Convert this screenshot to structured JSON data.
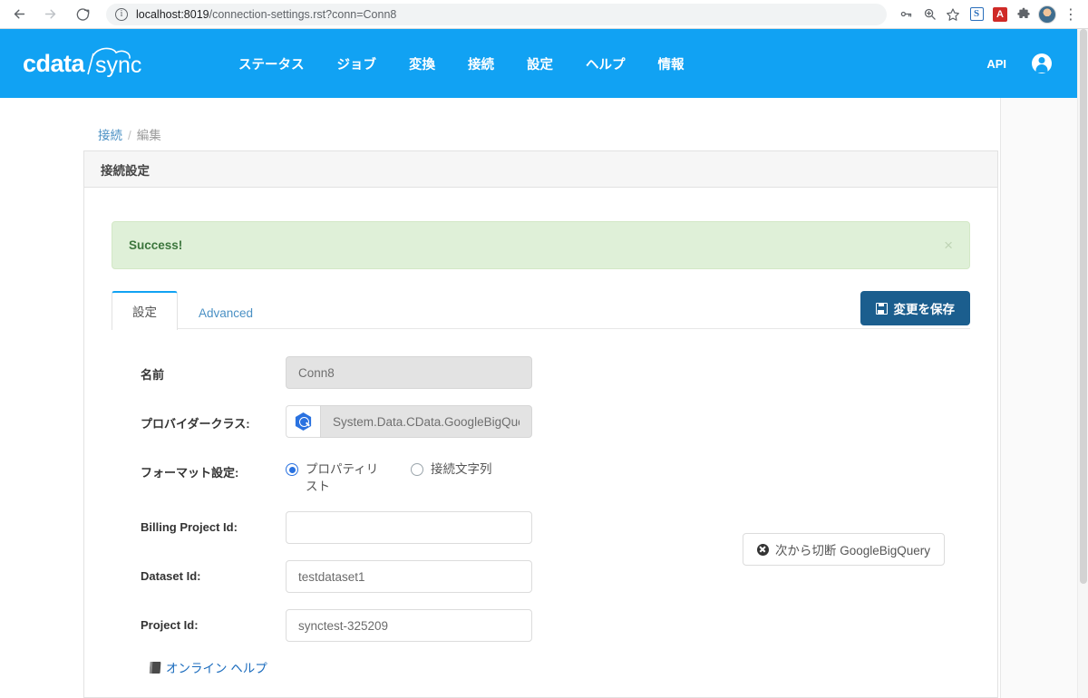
{
  "browser": {
    "back_icon": "back-arrow-icon",
    "forward_icon": "forward-arrow-icon",
    "reload_icon": "reload-icon",
    "site_info_icon": "info-icon",
    "url_host": "localhost:8019",
    "url_path": "/connection-settings.rst?conn=Conn8",
    "url_full": "localhost:8019/connection-settings.rst?conn=Conn8",
    "toolbar_icons": [
      {
        "name": "password-key-icon",
        "glyph": "⚷"
      },
      {
        "name": "zoom-icon",
        "glyph": "⊕"
      },
      {
        "name": "bookmark-star-icon",
        "glyph": "☆"
      },
      {
        "name": "extension-s-icon",
        "glyph": "S"
      },
      {
        "name": "adobe-pdf-icon",
        "glyph": "A"
      },
      {
        "name": "extensions-puzzle-icon",
        "glyph": "❖"
      },
      {
        "name": "profile-avatar",
        "glyph": ""
      },
      {
        "name": "chrome-menu-icon",
        "glyph": "⋮"
      }
    ]
  },
  "header": {
    "brand": "cdata sync",
    "brand_primary": "cdata",
    "brand_secondary": "sync",
    "nav": [
      {
        "label": "ステータス",
        "name": "nav-status"
      },
      {
        "label": "ジョブ",
        "name": "nav-jobs"
      },
      {
        "label": "変換",
        "name": "nav-transform"
      },
      {
        "label": "接続",
        "name": "nav-connections"
      },
      {
        "label": "設定",
        "name": "nav-settings"
      },
      {
        "label": "ヘルプ",
        "name": "nav-help"
      },
      {
        "label": "情報",
        "name": "nav-info"
      }
    ],
    "api_label": "API",
    "user_icon": "user-account-icon",
    "background_color": "#11a2f3"
  },
  "breadcrumb": {
    "parent": "接続",
    "separator": "/",
    "current": "編集"
  },
  "panel": {
    "title": "接続設定"
  },
  "alert": {
    "message": "Success!",
    "close_label": "×",
    "background_color": "#dff0d8",
    "text_color": "#3c763d"
  },
  "tabs": [
    {
      "label": "設定",
      "name": "tab-settings",
      "active": true
    },
    {
      "label": "Advanced",
      "name": "tab-advanced",
      "active": false
    }
  ],
  "toolbar": {
    "save_label": "変更を保存",
    "save_icon": "save-floppy-icon",
    "save_color": "#1b5e8e"
  },
  "form": {
    "fields": [
      {
        "name": "connection-name",
        "label": "名前",
        "value": "Conn8",
        "placeholder": "",
        "disabled": true,
        "type": "text"
      },
      {
        "name": "provider-class",
        "label": "プロバイダークラス:",
        "value": "System.Data.CData.GoogleBigQue",
        "placeholder": "",
        "disabled": true,
        "type": "text-with-icon",
        "icon": "google-bigquery-icon"
      },
      {
        "name": "billing-project-id",
        "label": "Billing Project Id:",
        "value": "",
        "placeholder": "",
        "disabled": false,
        "type": "text"
      },
      {
        "name": "dataset-id",
        "label": "Dataset Id:",
        "value": "testdataset1",
        "placeholder": "",
        "disabled": false,
        "type": "text"
      },
      {
        "name": "project-id",
        "label": "Project Id:",
        "value": "synctest-325209",
        "placeholder": "",
        "disabled": false,
        "type": "text"
      }
    ],
    "format_setting": {
      "label": "フォーマット設定:",
      "options": [
        {
          "label": "プロパティリスト",
          "name": "radio-property-list",
          "selected": true
        },
        {
          "label": "接続文字列",
          "name": "radio-connection-string",
          "selected": false
        }
      ]
    }
  },
  "disconnect_button": {
    "label": "次から切断 GoogleBigQuery",
    "icon": "times-circle-icon"
  },
  "help": {
    "label": "オンライン ヘルプ",
    "icon": "book-icon"
  }
}
